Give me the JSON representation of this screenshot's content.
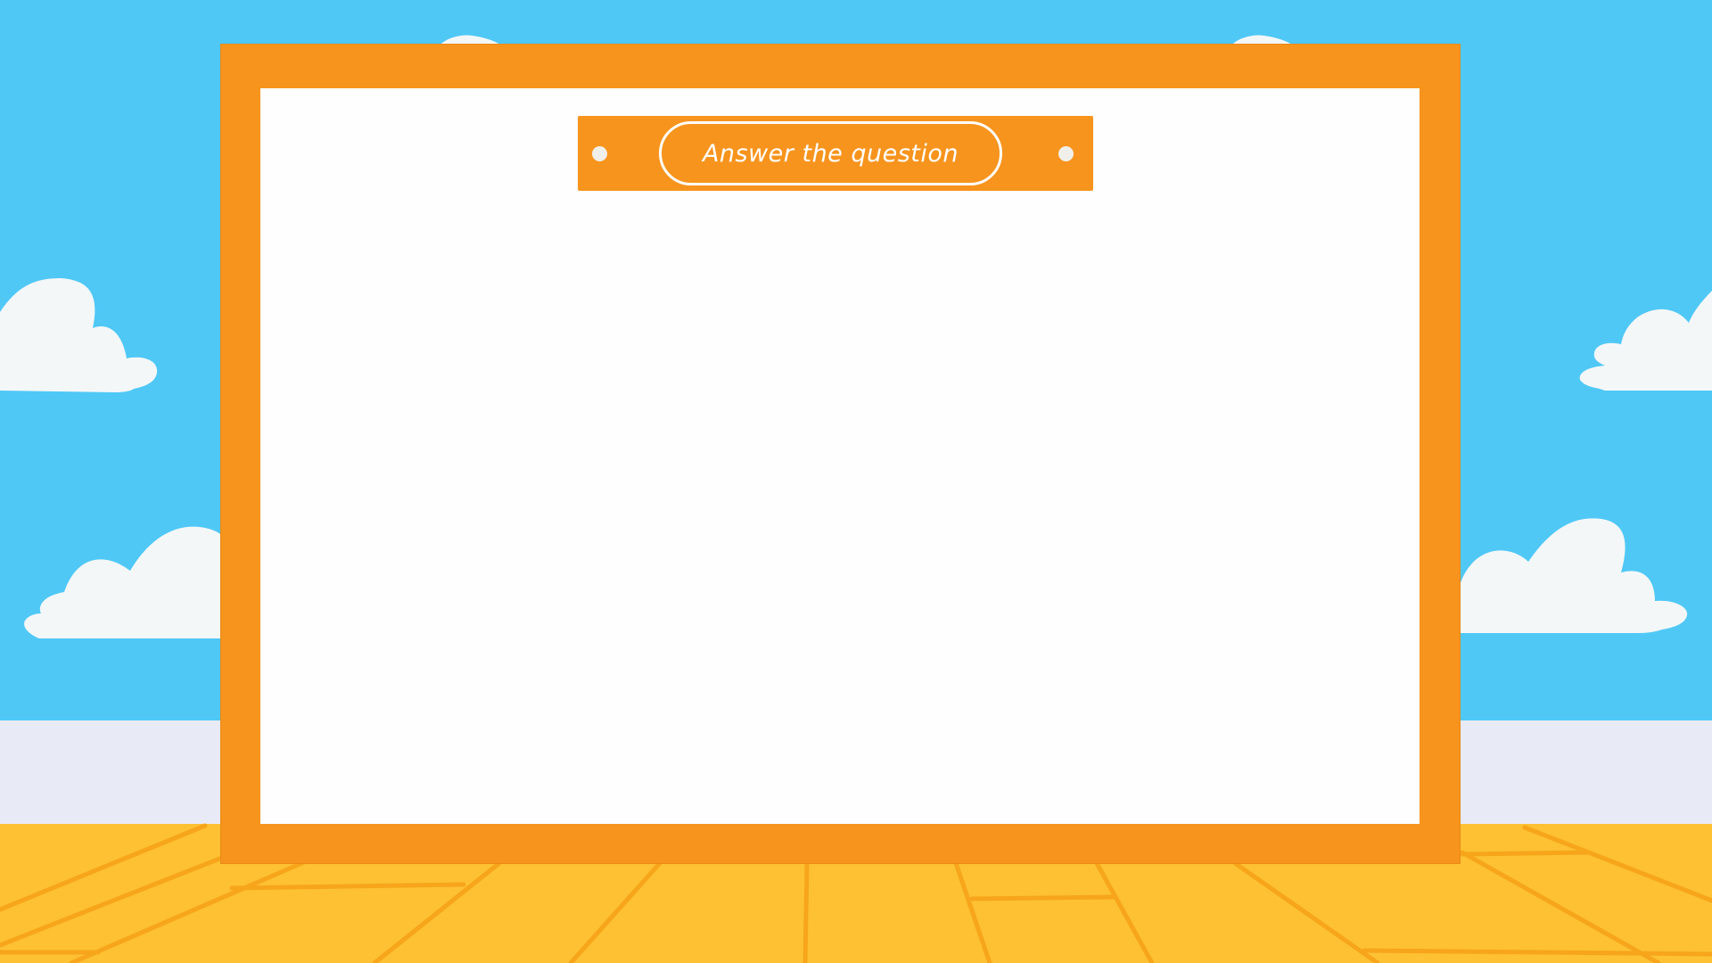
{
  "scene": {
    "title": "Answer the question",
    "colors": {
      "sky": "#4fc8f6",
      "wall": "#e8ebf5",
      "floor": "#fdc133",
      "floor_lines": "#f7a51b",
      "frame": "#f7941d",
      "panel": "#fefefe",
      "cloud": "#f4f7f8"
    },
    "icons": {
      "clouds": "cloud-icon",
      "plaque_dots": "dot-icon"
    }
  }
}
